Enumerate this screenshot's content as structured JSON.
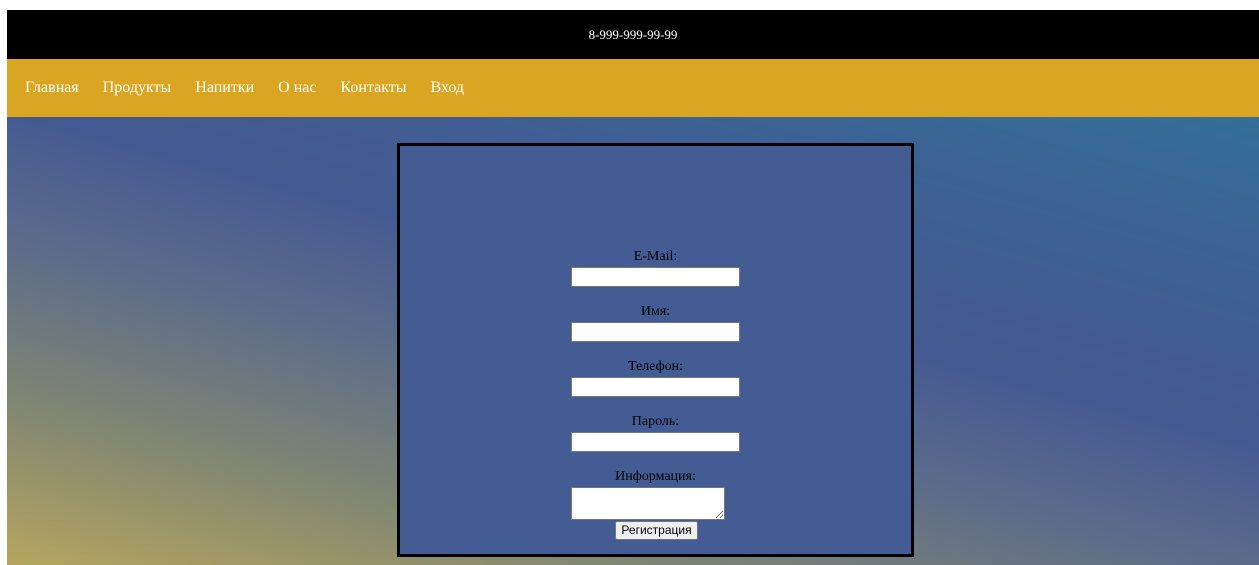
{
  "header": {
    "phone": "8-999-999-99-99"
  },
  "nav": {
    "items": [
      {
        "label": "Главная"
      },
      {
        "label": "Продукты"
      },
      {
        "label": "Напитки"
      },
      {
        "label": "О нас"
      },
      {
        "label": "Контакты"
      },
      {
        "label": "Вход"
      }
    ]
  },
  "form": {
    "email": {
      "label": "E-Mail:",
      "value": ""
    },
    "name": {
      "label": "Имя:",
      "value": ""
    },
    "phone": {
      "label": "Телефон:",
      "value": ""
    },
    "password": {
      "label": "Пароль:",
      "value": ""
    },
    "info": {
      "label": "Информация:",
      "value": ""
    },
    "submit_label": "Регистрация"
  },
  "colors": {
    "topbar": "#000000",
    "nav": "#daa520",
    "form_bg": "#435c94",
    "text_light": "#ffffff"
  }
}
